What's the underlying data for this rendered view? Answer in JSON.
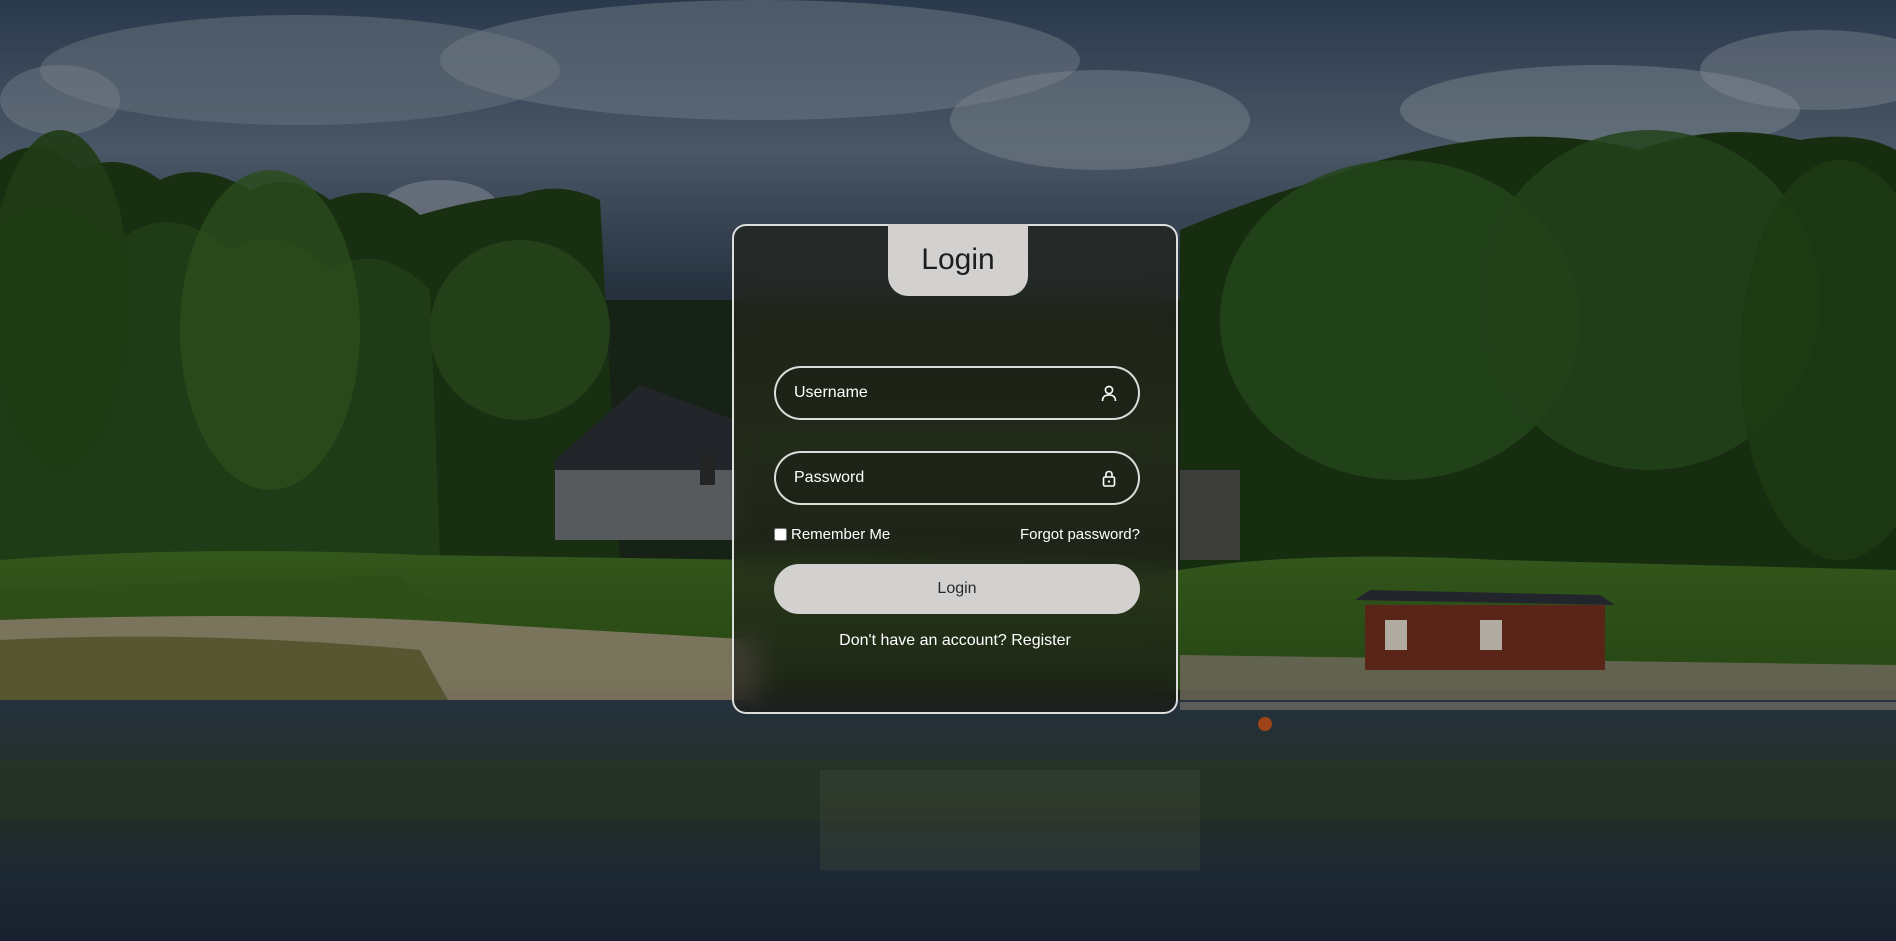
{
  "login": {
    "title": "Login",
    "username_placeholder": "Username",
    "password_placeholder": "Password",
    "remember_label": "Remember Me",
    "forgot_label": "Forgot password?",
    "submit_label": "Login",
    "register_prompt": "Don't have an account?",
    "register_link": "Register"
  },
  "icons": {
    "username": "user-icon",
    "password": "lock-icon"
  },
  "colors": {
    "card_border": "#ffffff",
    "tab_background": "#d3d1cf",
    "button_background": "#d3d1cf",
    "text": "#ffffff"
  }
}
